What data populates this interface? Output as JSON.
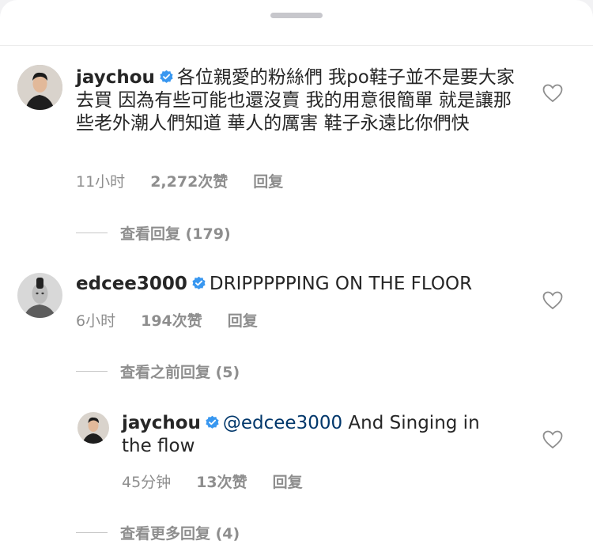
{
  "comments": [
    {
      "username": "jaychou",
      "text": "各位親愛的粉絲們 我po鞋子並不是要大家去買 因為有些可能也還沒賣 我的用意很簡單 就是讓那些老外潮人們知道 華人的厲害 鞋子永遠比你們快",
      "time": "11小时",
      "likes": "2,272次赞",
      "reply_label": "回复",
      "view_replies": "查看回复 (179)"
    },
    {
      "username": "edcee3000",
      "text": "DRIPPPPPING ON THE FLOOR",
      "time": "6小时",
      "likes": "194次赞",
      "reply_label": "回复",
      "view_replies": "查看之前回复 (5)"
    }
  ],
  "reply": {
    "username": "jaychou",
    "mention": "@edcee3000",
    "text": " And Singing in the flow",
    "time": "45分钟",
    "likes": "13次赞",
    "reply_label": "回复",
    "view_more": "查看更多回复 (4)"
  },
  "colors": {
    "verified": "#3897f0",
    "mention": "#00376b",
    "meta": "#8e8e8e"
  },
  "icons": {
    "like": "heart-outline-icon",
    "verified": "verified-badge-icon"
  }
}
